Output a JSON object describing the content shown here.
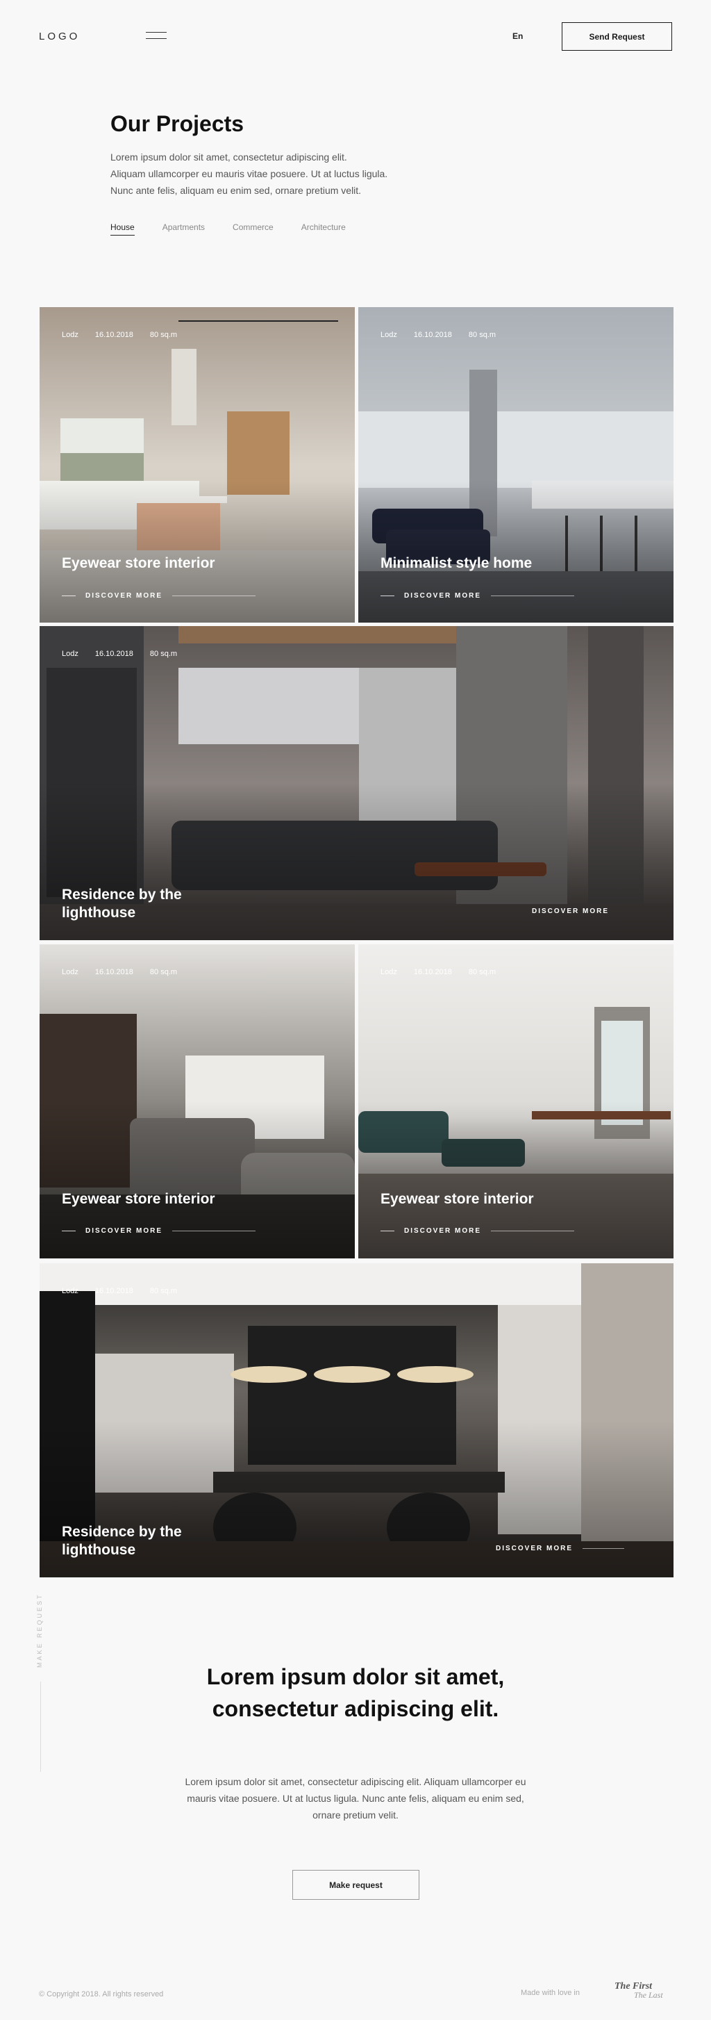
{
  "header": {
    "logo": "LOGO",
    "lang": "En",
    "send_request": "Send Request"
  },
  "intro": {
    "title": "Our Projects",
    "lines": [
      "Lorem ipsum dolor sit amet, consectetur adipiscing elit.",
      "Aliquam ullamcorper eu mauris vitae posuere. Ut at luctus ligula.",
      "Nunc ante felis, aliquam eu enim sed, ornare pretium velit."
    ]
  },
  "filters": [
    "House",
    "Apartments",
    "Commerce",
    "Architecture"
  ],
  "active_filter": "House",
  "projects": [
    {
      "city": "Lodz",
      "date": "16.10.2018",
      "area": "80 sq.m",
      "title": "Eyewear store interior",
      "cta": "DISCOVER MORE"
    },
    {
      "city": "Lodz",
      "date": "16.10.2018",
      "area": "80 sq.m",
      "title": "Minimalist style home",
      "cta": "DISCOVER MORE"
    },
    {
      "city": "Lodz",
      "date": "16.10.2018",
      "area": "80 sq.m",
      "title": "Residence by the lighthouse",
      "cta": "DISCOVER MORE"
    },
    {
      "city": "Lodz",
      "date": "16.10.2018",
      "area": "80 sq.m",
      "title": "Eyewear store interior",
      "cta": "DISCOVER MORE"
    },
    {
      "city": "Lodz",
      "date": "16.10.2018",
      "area": "80 sq.m",
      "title": "Eyewear store interior",
      "cta": "DISCOVER MORE"
    },
    {
      "city": "Lodz",
      "date": "16.10.2018",
      "area": "80 sq.m",
      "title": "Residence by the lighthouse",
      "cta": "DISCOVER MORE"
    }
  ],
  "cta": {
    "side_label": "MAKE REQUEST",
    "title": "Lorem ipsum dolor sit amet, consectetur adipiscing elit.",
    "text": "Lorem ipsum dolor sit amet, consectetur adipiscing elit. Aliquam ullamcorper eu mauris vitae posuere. Ut at luctus ligula. Nunc ante felis, aliquam eu enim sed, ornare pretium velit.",
    "button": "Make request"
  },
  "footer": {
    "copyright": "© Copyright 2018. All rights reserved",
    "made": "Made with love in",
    "brand_top": "The First",
    "brand_bottom": "The Last"
  }
}
